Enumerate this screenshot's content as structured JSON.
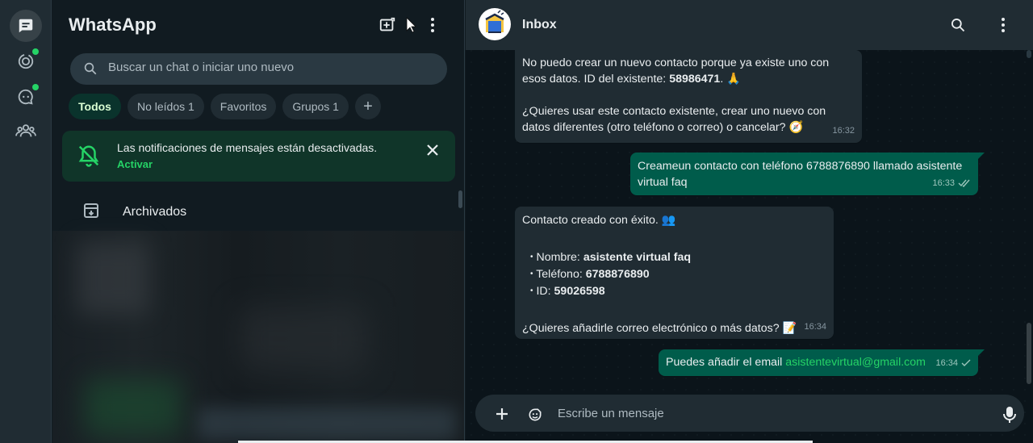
{
  "app": {
    "title": "WhatsApp"
  },
  "rail": {
    "items": [
      {
        "name": "chats-icon",
        "active": true
      },
      {
        "name": "status-icon",
        "badge": true
      },
      {
        "name": "channels-icon",
        "badge": true
      },
      {
        "name": "communities-icon"
      }
    ]
  },
  "search": {
    "placeholder": "Buscar un chat o iniciar uno nuevo"
  },
  "filters": [
    {
      "label": "Todos",
      "active": true
    },
    {
      "label": "No leídos 1"
    },
    {
      "label": "Favoritos"
    },
    {
      "label": "Grupos 1"
    },
    {
      "label": "+"
    }
  ],
  "notification": {
    "text": "Las notificaciones de mensajes están desactivadas.",
    "action": "Activar"
  },
  "archived": {
    "label": "Archivados"
  },
  "chat": {
    "title": "Inbox",
    "messages": {
      "m1": {
        "l1": "No puedo crear un nuevo contacto porque ya existe uno con",
        "l2a": "esos datos. ID del existente: ",
        "l2b": "58986471",
        "l2c": ". 🙏",
        "l3": "¿Quieres usar este contacto existente, crear uno nuevo con",
        "l4": "datos diferentes (otro teléfono o correo) o cancelar? 🧭",
        "time": "16:32"
      },
      "m2": {
        "l1": "Creameun contacto con teléfono 6788876890 llamado asistente",
        "l2": "virtual faq",
        "time": "16:33"
      },
      "m3": {
        "l1": "Contacto creado con éxito. 👥",
        "b1k": "Nombre: ",
        "b1v": "asistente virtual faq",
        "b2k": "Teléfono: ",
        "b2v": "6788876890",
        "b3k": "ID: ",
        "b3v": "59026598",
        "l5": "¿Quieres añadirle correo electrónico o más datos? 📝",
        "time": "16:34"
      },
      "m4": {
        "text": "Puedes añadir el email ",
        "email": "asistentevirtual@gmail.com",
        "time": "16:34"
      }
    }
  },
  "composer": {
    "placeholder": "Escribe un mensaje"
  },
  "colors": {
    "accent": "#25d366",
    "outgoing": "#005c4b",
    "incoming": "#202c33",
    "panel": "#111b21"
  }
}
